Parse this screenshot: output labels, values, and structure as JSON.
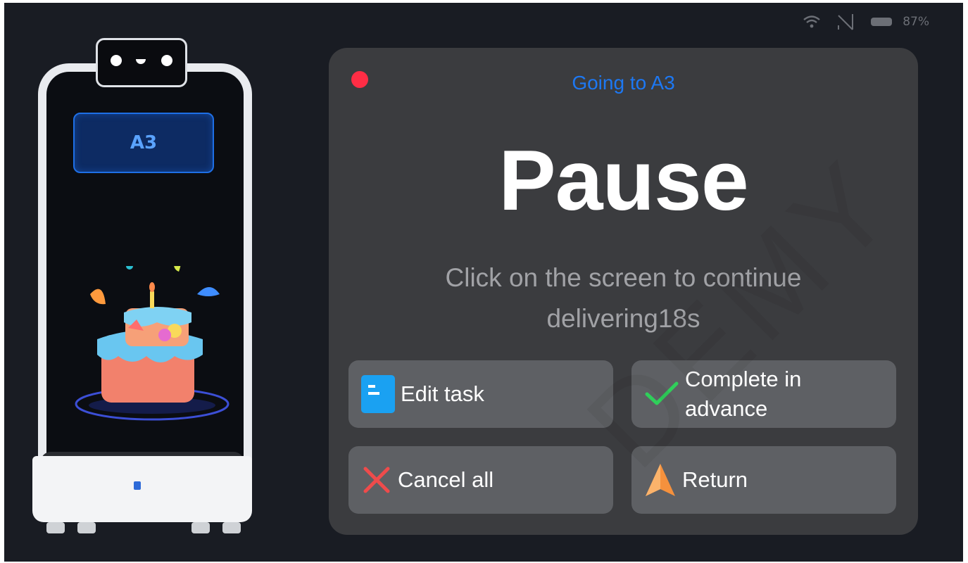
{
  "status_bar": {
    "battery_percent": "87%",
    "icons": [
      "wifi-icon",
      "no-signal-icon",
      "battery-icon"
    ]
  },
  "robot": {
    "display_label": "A3",
    "animation": "birthday-cake"
  },
  "dialog": {
    "destination": "Going to A3",
    "title": "Pause",
    "hint": "Click on the screen to continue delivering18s",
    "buttons": {
      "edit_task": "Edit task",
      "complete_in_advance": "Complete in advance",
      "cancel_all": "Cancel all",
      "return": "Return"
    }
  },
  "watermark": "DEMY",
  "colors": {
    "background": "#191c23",
    "dialog": "#3b3c3f",
    "button": "#5e6064",
    "accent_blue": "#1d78f3",
    "status_dot": "#ff2d45",
    "check_green": "#2fcf5a",
    "cancel_red": "#ef4b4b",
    "return_orange": "#f5913d"
  }
}
